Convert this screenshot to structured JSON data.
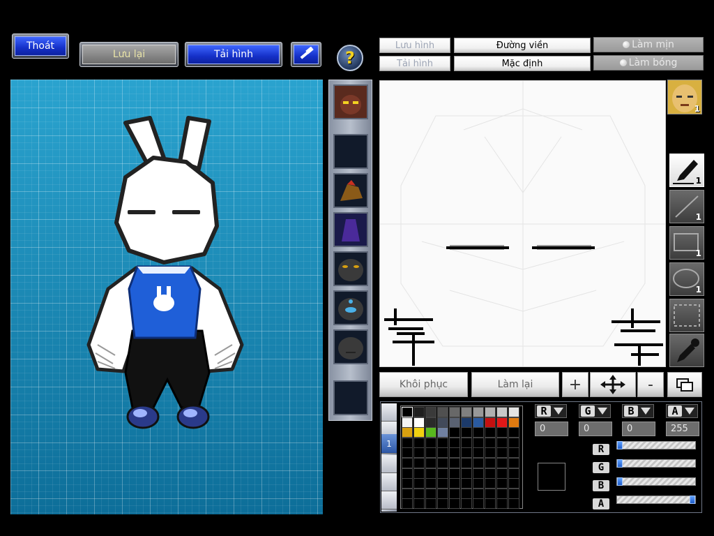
{
  "toolbar": {
    "exit_label": "Thoát",
    "save_label": "Lưu lại",
    "load_label": "Tải hình",
    "help_label": "?"
  },
  "header": {
    "save_image": "Lưu hình",
    "load_image": "Tải hình",
    "outline": "Đường viền",
    "default": "Mặc định",
    "smooth": "Làm mịn",
    "shade": "Làm bóng"
  },
  "tools": {
    "avatar_count": "1",
    "pen_count": "1",
    "line_count": "1",
    "rect_count": "1",
    "ellipse_count": "1"
  },
  "actions": {
    "restore_label": "Khôi phục",
    "redo_label": "Làm lại",
    "zoom_in": "+",
    "zoom_out": "-"
  },
  "palette": {
    "active_tab": "1",
    "colors": [
      "#000000",
      "#1e1e1e",
      "#3a3a3a",
      "#505050",
      "#686868",
      "#808080",
      "#989898",
      "#b0b0b0",
      "#c8c8c8",
      "#e4e4e4",
      "#f4f4f4",
      "#ffffff",
      "#2a2a2a",
      "#424a5a",
      "#5a6272",
      "#1c3a6a",
      "#2a5aa0",
      "#c41010",
      "#e01818",
      "#e07a10",
      "#d8a010",
      "#f0d010",
      "#58b81e",
      "#7080a0"
    ]
  },
  "channels": {
    "r": {
      "label": "R",
      "value": "0",
      "fraction": 0.0
    },
    "g": {
      "label": "G",
      "value": "0",
      "fraction": 0.0
    },
    "b": {
      "label": "B",
      "value": "0",
      "fraction": 0.0
    },
    "a": {
      "label": "A",
      "value": "255",
      "fraction": 1.0
    }
  },
  "colors": {
    "accent_blue": "#1530c8",
    "preview_bg": "#1a8bbb"
  }
}
